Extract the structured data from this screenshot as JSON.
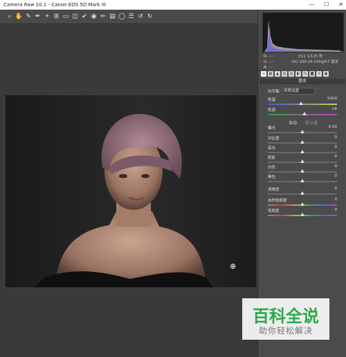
{
  "window": {
    "title": "Camera Raw 10.1 -  Canon EOS 5D Mark III",
    "controls": [
      "—",
      "☐",
      "✕"
    ]
  },
  "toolbar": {
    "tools": [
      "zoom-tool-icon",
      "hand-tool-icon",
      "white-balance-tool-icon",
      "color-sampler-icon",
      "targeted-adjustment-icon",
      "crop-tool-icon",
      "straighten-tool-icon",
      "transform-tool-icon",
      "spot-removal-icon",
      "red-eye-icon",
      "adjustment-brush-icon",
      "graduated-filter-icon",
      "radial-filter-icon",
      "preferences-icon",
      "rotate-ccw-icon",
      "rotate-cw-icon"
    ],
    "glyphs": [
      "⌕",
      "✋",
      "✎",
      "✒",
      "⌖",
      "⊞",
      "▭",
      "◫",
      "✔",
      "◉",
      "✏",
      "▤",
      "◯",
      "☰",
      "↺",
      "↻"
    ]
  },
  "histogram": {
    "info_line1_left": "R:  ---",
    "info_line2_left": "G:  ---",
    "info_line3_left": "B:  ---",
    "info_line1_right": "f/11   1/125 秒",
    "info_line2_right": "ISO 100   24-105@67 毫米"
  },
  "panel": {
    "section_title": "基本",
    "white_balance_label": "白平衡:",
    "white_balance_value": "原照设置",
    "auto_label": "自动",
    "default_label": "默认值",
    "colors": {
      "accent": "#dcdcdc",
      "panel_bg": "#4b4b4b"
    },
    "sliders": [
      {
        "label": "色温",
        "value": "5200",
        "pos": 0.48,
        "gradient": "temp"
      },
      {
        "label": "色调",
        "value": "+6",
        "pos": 0.53,
        "gradient": "tint"
      },
      {
        "label": "曝光",
        "value": "0.00",
        "pos": 0.5,
        "gradient": "none"
      },
      {
        "label": "对比度",
        "value": "0",
        "pos": 0.5,
        "gradient": "none"
      },
      {
        "label": "高光",
        "value": "0",
        "pos": 0.5,
        "gradient": "none"
      },
      {
        "label": "阴影",
        "value": "0",
        "pos": 0.5,
        "gradient": "none"
      },
      {
        "label": "白色",
        "value": "0",
        "pos": 0.5,
        "gradient": "none"
      },
      {
        "label": "黑色",
        "value": "0",
        "pos": 0.5,
        "gradient": "none"
      },
      {
        "label": "清晰度",
        "value": "0",
        "pos": 0.5,
        "gradient": "none"
      },
      {
        "label": "自然饱和度",
        "value": "0",
        "pos": 0.5,
        "gradient": "vib"
      },
      {
        "label": "饱和度",
        "value": "0",
        "pos": 0.5,
        "gradient": "vib"
      }
    ]
  },
  "watermark": {
    "line1": "百科全说",
    "line2": "助你轻松解决"
  }
}
